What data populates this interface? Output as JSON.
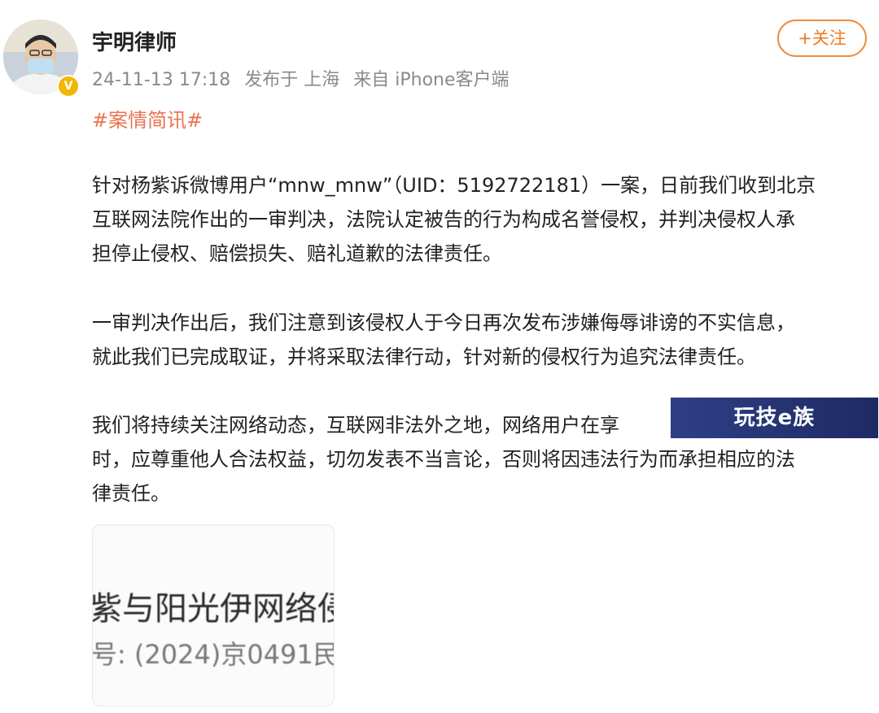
{
  "post": {
    "username": "宇明律师",
    "timestamp": "24-11-13 17:18",
    "published_at": "发布于 上海",
    "source": "来自 iPhone客户端",
    "follow_label": "+关注",
    "hashtag": "#案情简讯#",
    "paragraphs": [
      {
        "lines": [
          "针对杨紫诉微博用户“mnw_mnw”（UID：5192722181）一案，日前我们收到北京",
          "互联网法院作出的一审判决，法院认定被告的行为构成名誉侵权，并判决侵权人承",
          "担停止侵权、赔偿损失、赔礼道歉的法律责任。"
        ]
      },
      {
        "lines": [
          "一审判决作出后，我们注意到该侵权人于今日再次发布涉嫌侮辱诽谤的不实信息，",
          "就此我们已完成取证，并将采取法律行动，针对新的侵权行为追究法律责任。"
        ]
      },
      {
        "lines": [
          "我们将持续关注网络动态，互联网非法外之地，网络用户在享",
          "时，应尊重他人合法权益，切勿发表不当言论，否则将因违法行为而承担相应的法",
          "律责任。"
        ]
      }
    ]
  },
  "watermark": {
    "text": "玩技e族"
  },
  "thumbnail": {
    "line1": "紫与阳光伊网络侵",
    "line2": "号: (2024)京0491民"
  },
  "icons": {
    "avatar": "avatar-photo",
    "verified": "verified-badge-icon"
  },
  "colors": {
    "accent_orange": "#f07a25",
    "hashtag": "#eb7350",
    "meta_gray": "#8a8a8a",
    "watermark_bg": "#1e2a63"
  }
}
